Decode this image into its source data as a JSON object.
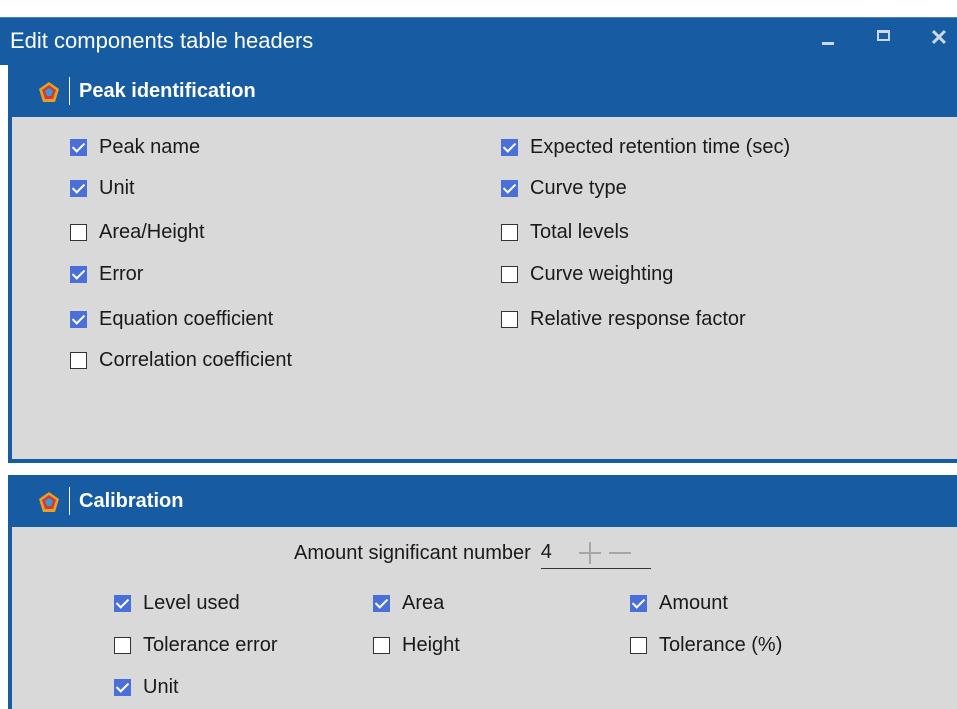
{
  "window": {
    "title": "Edit components table headers"
  },
  "peak_identification": {
    "title": "Peak identification",
    "left_column": [
      {
        "label": "Peak name",
        "checked": true
      },
      {
        "label": "Unit",
        "checked": true
      },
      {
        "label": "Area/Height",
        "checked": false
      },
      {
        "label": "Error",
        "checked": true
      },
      {
        "label": "Equation coefficient",
        "checked": true
      },
      {
        "label": "Correlation coefficient",
        "checked": false
      }
    ],
    "right_column": [
      {
        "label": "Expected retention time (sec)",
        "checked": true
      },
      {
        "label": "Curve type",
        "checked": true
      },
      {
        "label": "Total levels",
        "checked": false
      },
      {
        "label": "Curve weighting",
        "checked": false
      },
      {
        "label": "Relative response factor",
        "checked": false
      }
    ]
  },
  "calibration": {
    "title": "Calibration",
    "amount_label": "Amount significant number",
    "amount_value": "4",
    "items": [
      {
        "label": "Level used",
        "checked": true
      },
      {
        "label": "Area",
        "checked": true
      },
      {
        "label": "Amount",
        "checked": true
      },
      {
        "label": "Tolerance error",
        "checked": false
      },
      {
        "label": "Height",
        "checked": false
      },
      {
        "label": "Tolerance (%)",
        "checked": false
      },
      {
        "label": "Unit",
        "checked": true
      }
    ]
  },
  "colors": {
    "accent": "#175ba3",
    "panel_bg": "#d9d9d9",
    "checkbox_checked": "#4a6fd8"
  }
}
